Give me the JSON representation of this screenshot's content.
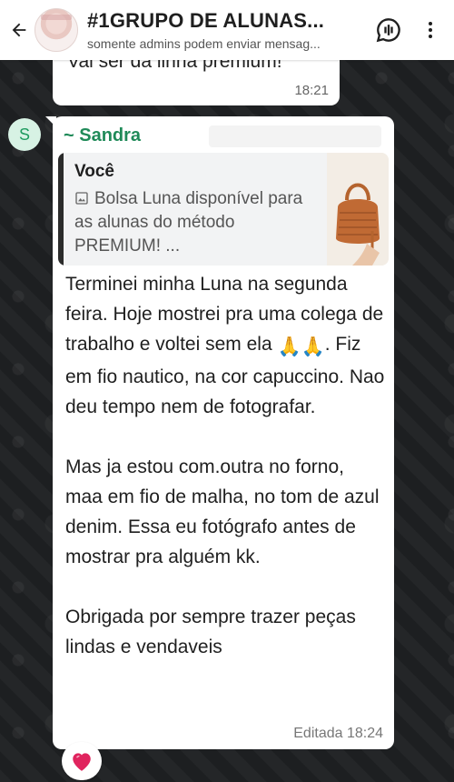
{
  "header": {
    "title": "#1GRUPO DE ALUNAS...",
    "subtitle": "somente admins podem enviar mensag...",
    "back_icon": "arrow-left-icon",
    "voice_chat_icon": "voice-chat-icon",
    "menu_icon": "more-vert-icon"
  },
  "previous_message": {
    "text": "Vai ser da linha premium!",
    "time": "18:21"
  },
  "message": {
    "avatar_letter": "S",
    "sender": "~ Sandra",
    "quote": {
      "author": "Você",
      "icon": "image-icon",
      "text": "Bolsa Luna disponível para as alunas do  método PREMIUM! ..."
    },
    "para1_pre": "Terminei minha Luna na segunda feira. Hoje mostrei pra uma colega de trabalho e voltei sem ela ",
    "emoji": "🙏🙏",
    "para1_post": ". Fiz em fio nautico, na cor capuccino. Nao deu tempo nem de fotografar.",
    "para2": "Mas ja estou com.outra no forno, maa em fio de malha, no tom de azul denim. Essa eu fotógrafo antes de mostrar pra alguém kk.",
    "para3": "Obrigada por sempre trazer peças lindas e vendaveis",
    "time": "Editada 18:24",
    "reaction": "❤️"
  },
  "colors": {
    "sender_name": "#1f8a58",
    "reaction_heart": "#e0245e"
  }
}
